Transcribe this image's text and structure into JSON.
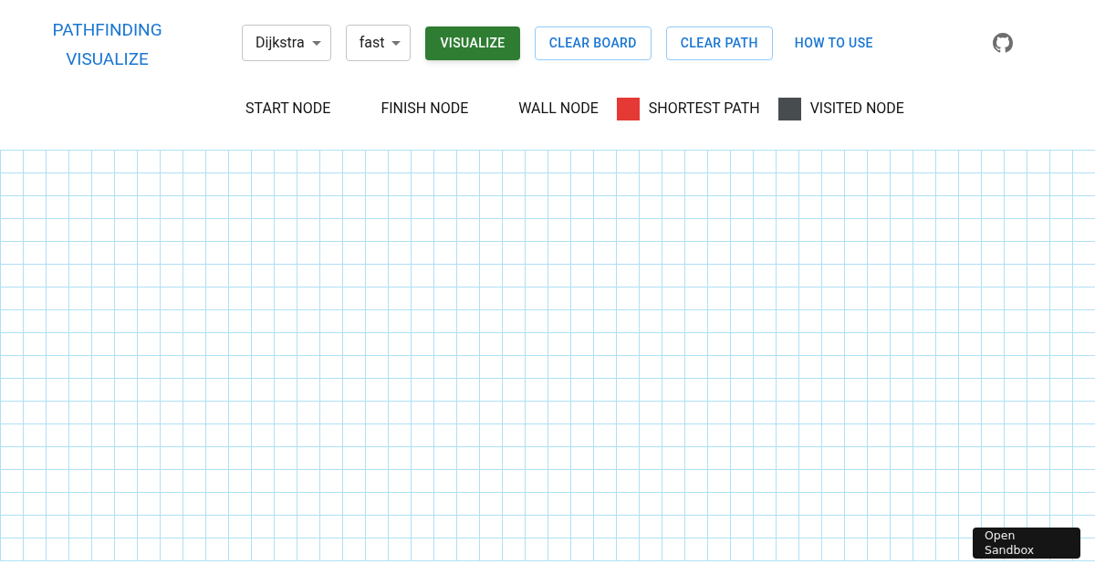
{
  "title": [
    "PATHFINDING",
    "VISUALIZE"
  ],
  "selects": [
    {
      "value": "Dijkstra"
    },
    {
      "value": "fast"
    }
  ],
  "buttons": [
    {
      "label": "VISUALIZE",
      "kind": "contained"
    },
    {
      "label": "CLEAR BOARD",
      "kind": "outlined"
    },
    {
      "label": "CLEAR PATH",
      "kind": "outlined"
    },
    {
      "label": "HOW TO USE",
      "kind": "text"
    }
  ],
  "legend": [
    {
      "label": "START NODE"
    },
    {
      "label": "FINISH NODE"
    },
    {
      "label": "WALL NODE"
    },
    {
      "label": "SHORTEST PATH",
      "color": "#e53935"
    },
    {
      "label": "VISITED NODE",
      "color": "#474d4e"
    }
  ],
  "sandbox_badge": [
    "Open",
    "Sandbox"
  ]
}
